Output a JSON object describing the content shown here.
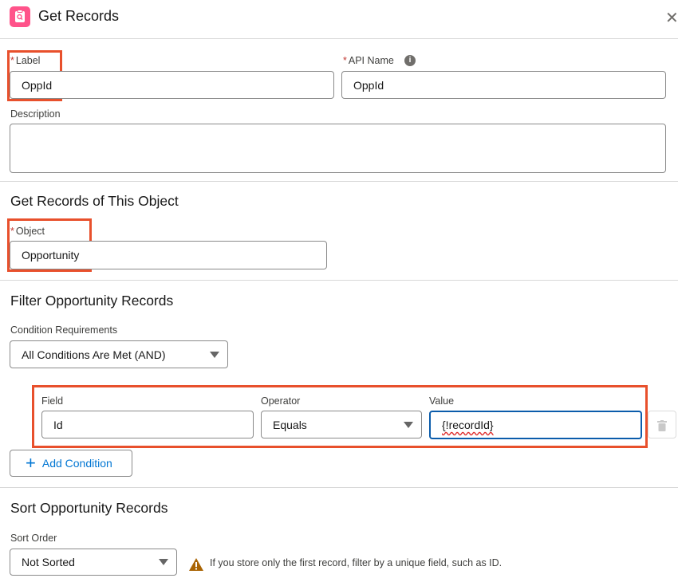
{
  "header": {
    "title": "Get Records",
    "icon": "get-records-icon",
    "icon_color": "#ff538a",
    "close_icon": "close-icon"
  },
  "label_field": {
    "label": "Label",
    "value": "OppId"
  },
  "api_name_field": {
    "label": "API Name",
    "value": "OppId",
    "info_icon": "info-icon"
  },
  "description_field": {
    "label": "Description",
    "value": ""
  },
  "object_section": {
    "title": "Get Records of This Object",
    "object_label": "Object",
    "object_value": "Opportunity"
  },
  "filter_section": {
    "title": "Filter Opportunity Records",
    "condition_label": "Condition Requirements",
    "condition_value": "All Conditions Are Met (AND)",
    "condition": {
      "field_label": "Field",
      "field_value": "Id",
      "operator_label": "Operator",
      "operator_value": "Equals",
      "value_label": "Value",
      "value_value": "{!recordId}"
    },
    "add_condition": "Add Condition"
  },
  "sort_section": {
    "title": "Sort Opportunity Records",
    "sort_label": "Sort Order",
    "sort_value": "Not Sorted",
    "warning": "If you store only the first record, filter by a unique field, such as ID."
  },
  "colors": {
    "highlight": "#e8502c",
    "focus": "#0b5cab",
    "link": "#0176d3"
  }
}
